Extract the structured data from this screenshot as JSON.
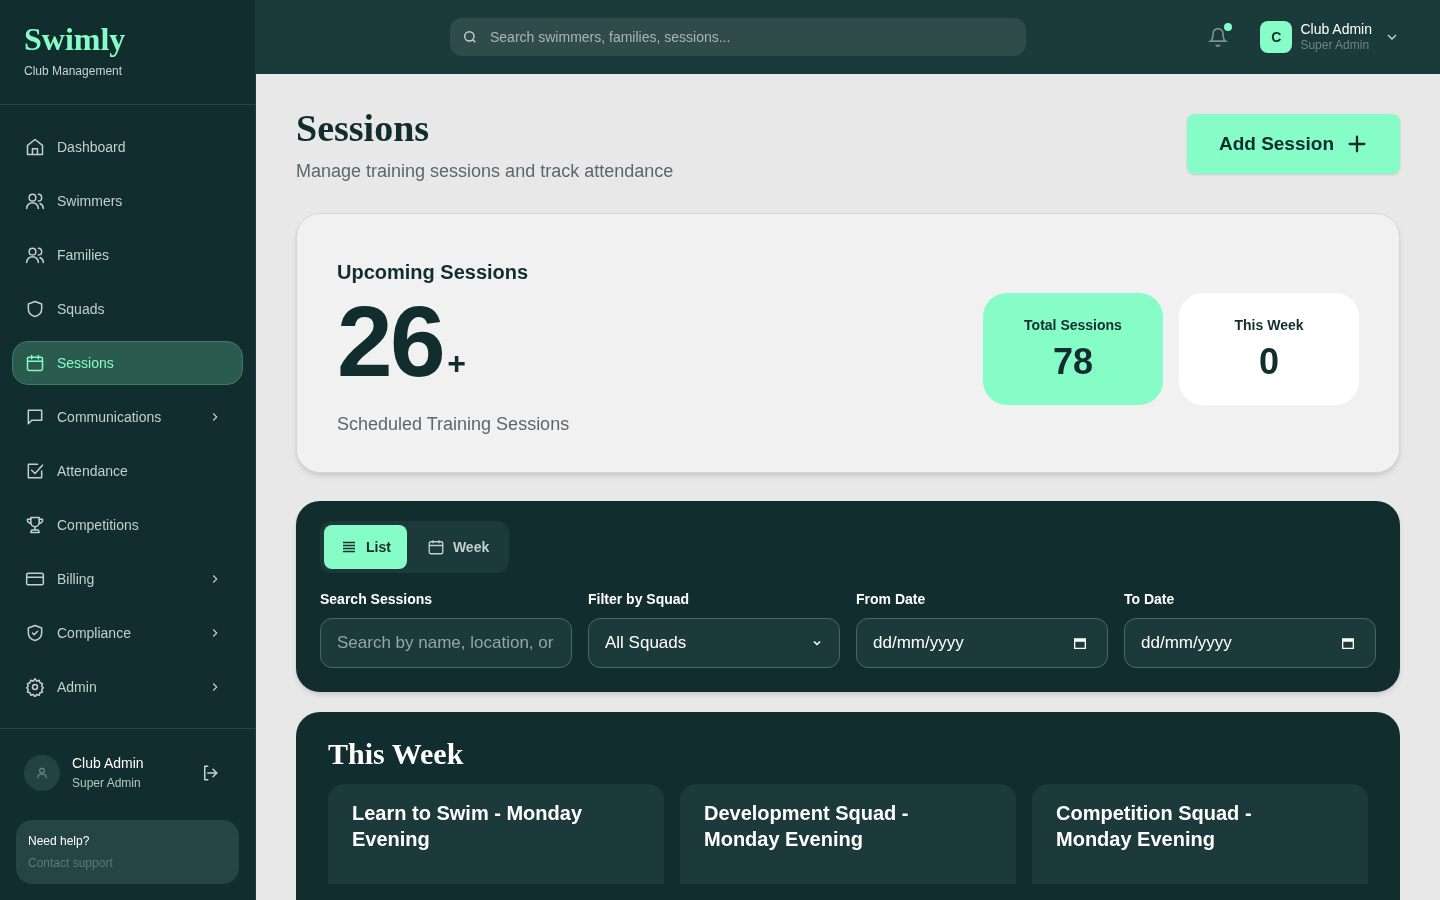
{
  "brand": {
    "name": "Swimly",
    "tagline": "Club Management"
  },
  "sidebar": {
    "items": [
      {
        "label": "Dashboard",
        "selected": false,
        "expandable": false
      },
      {
        "label": "Swimmers",
        "selected": false,
        "expandable": false
      },
      {
        "label": "Families",
        "selected": false,
        "expandable": false
      },
      {
        "label": "Squads",
        "selected": false,
        "expandable": false
      },
      {
        "label": "Sessions",
        "selected": true,
        "expandable": false
      },
      {
        "label": "Communications",
        "selected": false,
        "expandable": true
      },
      {
        "label": "Attendance",
        "selected": false,
        "expandable": false
      },
      {
        "label": "Competitions",
        "selected": false,
        "expandable": false
      },
      {
        "label": "Billing",
        "selected": false,
        "expandable": true
      },
      {
        "label": "Compliance",
        "selected": false,
        "expandable": true
      },
      {
        "label": "Admin",
        "selected": false,
        "expandable": true
      }
    ],
    "user": {
      "name": "Club Admin",
      "role": "Super Admin"
    },
    "help": {
      "title": "Need help?",
      "link": "Contact support"
    }
  },
  "topbar": {
    "search": {
      "placeholder": "Search swimmers, families, sessions..."
    },
    "notification_unread": true,
    "user": {
      "initial": "C",
      "name": "Club Admin",
      "role": "Super Admin"
    }
  },
  "header": {
    "title": "Sessions",
    "subtitle": "Manage training sessions and track attendance",
    "action": "Add Session"
  },
  "summary": {
    "title": "Upcoming Sessions",
    "count": "26",
    "suffix": "+",
    "caption": "Scheduled Training Sessions",
    "stats": [
      {
        "label": "Total Sessions",
        "value": "78",
        "highlight": true
      },
      {
        "label": "This Week",
        "value": "0",
        "highlight": false
      }
    ]
  },
  "filters": {
    "views": [
      {
        "label": "List",
        "selected": true
      },
      {
        "label": "Week",
        "selected": false
      }
    ],
    "fields": [
      {
        "kind": "text",
        "label": "Search Sessions",
        "placeholder": "Search by name, location, or"
      },
      {
        "kind": "select",
        "label": "Filter by Squad",
        "value": "All Squads"
      },
      {
        "kind": "date",
        "label": "From Date",
        "placeholder": "dd/mm/yyyy"
      },
      {
        "kind": "date",
        "label": "To Date",
        "placeholder": "dd/mm/yyyy"
      }
    ]
  },
  "this_week": {
    "title": "This Week",
    "sessions": [
      {
        "title": "Learn to Swim - Monday Evening"
      },
      {
        "title": "Development Squad - Monday Evening"
      },
      {
        "title": "Competition Squad - Monday Evening"
      }
    ]
  }
}
